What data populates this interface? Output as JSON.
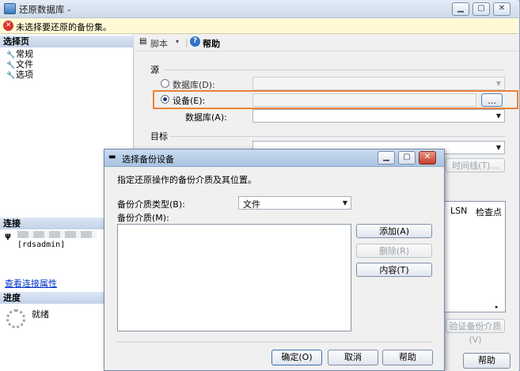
{
  "window": {
    "title": "还原数据库 -"
  },
  "warning": {
    "text": "未选择要还原的备份集。"
  },
  "left": {
    "select_page_header": "选择页",
    "pages": [
      {
        "label": "常规"
      },
      {
        "label": "文件"
      },
      {
        "label": "选项"
      }
    ],
    "connection_header": "连接",
    "connection_user": "[rdsadmin]",
    "view_conn_link": "查看连接属性",
    "progress_header": "进度",
    "progress_status": "就绪"
  },
  "toolbar": {
    "script_label": "脚本",
    "help_label": "帮助"
  },
  "source": {
    "header": "源",
    "database_radio": "数据库(D):",
    "device_radio": "设备(E):",
    "browse_button": "...",
    "database_label": "数据库(A):"
  },
  "target": {
    "header": "目标",
    "timeline_button": "时间线(T)..."
  },
  "grid": {
    "col_lsn": "LSN",
    "col_checkpoint": "检查点"
  },
  "verify_button": "验证备份介质(V)",
  "help_button": "帮助",
  "dialog": {
    "title": "选择备份设备",
    "instruction": "指定还原操作的备份介质及其位置。",
    "media_type_label": "备份介质类型(B):",
    "media_type_value": "文件",
    "media_label": "备份介质(M):",
    "add_button": "添加(A)",
    "remove_button": "删除(R)",
    "contents_button": "内容(T)",
    "ok_button": "确定(O)",
    "cancel_button": "取消",
    "help_button": "帮助"
  },
  "colors": {
    "highlight": "#e8823a",
    "link": "#0033cc",
    "error": "#d9352b"
  }
}
